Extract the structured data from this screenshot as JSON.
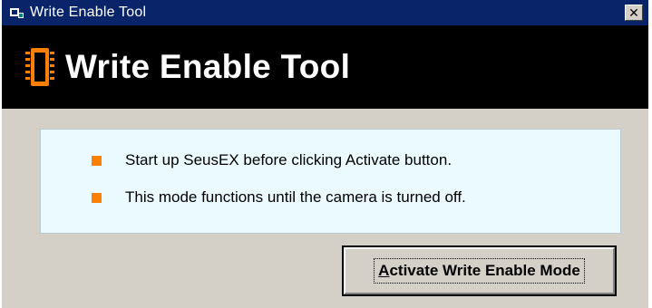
{
  "window": {
    "title": "Write Enable Tool",
    "close_glyph": "✕"
  },
  "banner": {
    "title": "Write Enable Tool",
    "icon": "chip-icon",
    "accent_color": "#ff7f00"
  },
  "info": {
    "lines": [
      "Start up SeusEX before clicking Activate button.",
      "This mode functions until the camera is turned off."
    ],
    "bullet_color": "#ff7f00",
    "background": "#eafaff"
  },
  "actions": {
    "activate_mnemonic": "A",
    "activate_rest": "ctivate Write Enable Mode"
  }
}
